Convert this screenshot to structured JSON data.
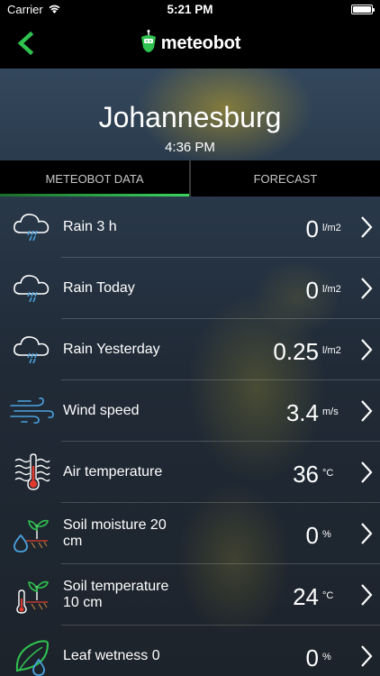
{
  "status_bar": {
    "carrier": "Carrier",
    "time": "5:21 PM"
  },
  "nav": {
    "logo_text": "meteobot"
  },
  "header": {
    "city": "Johannesburg",
    "time": "4:36 PM"
  },
  "tabs": [
    {
      "label": "METEOBOT DATA",
      "active": true
    },
    {
      "label": "FORECAST",
      "active": false
    }
  ],
  "rows": [
    {
      "label": "Rain 3 h",
      "value": "0",
      "unit": "l/m2",
      "icon": "rain-cloud-icon"
    },
    {
      "label": "Rain Today",
      "value": "0",
      "unit": "l/m2",
      "icon": "rain-cloud-icon"
    },
    {
      "label": "Rain Yesterday",
      "value": "0.25",
      "unit": "l/m2",
      "icon": "rain-cloud-icon"
    },
    {
      "label": "Wind speed",
      "value": "3.4",
      "unit": "m/s",
      "icon": "wind-icon"
    },
    {
      "label": "Air temperature",
      "value": "36",
      "unit": "°C",
      "icon": "thermometer-icon"
    },
    {
      "label": "Soil moisture 20 cm",
      "value": "0",
      "unit": "%",
      "icon": "soil-moisture-icon"
    },
    {
      "label": "Soil temperature 10 cm",
      "value": "24",
      "unit": "°C",
      "icon": "soil-temperature-icon"
    },
    {
      "label": "Leaf wetness 0",
      "value": "0",
      "unit": "%",
      "icon": "leaf-wetness-icon"
    }
  ],
  "colors": {
    "accent": "#3dd460",
    "background": "#1c2027"
  }
}
